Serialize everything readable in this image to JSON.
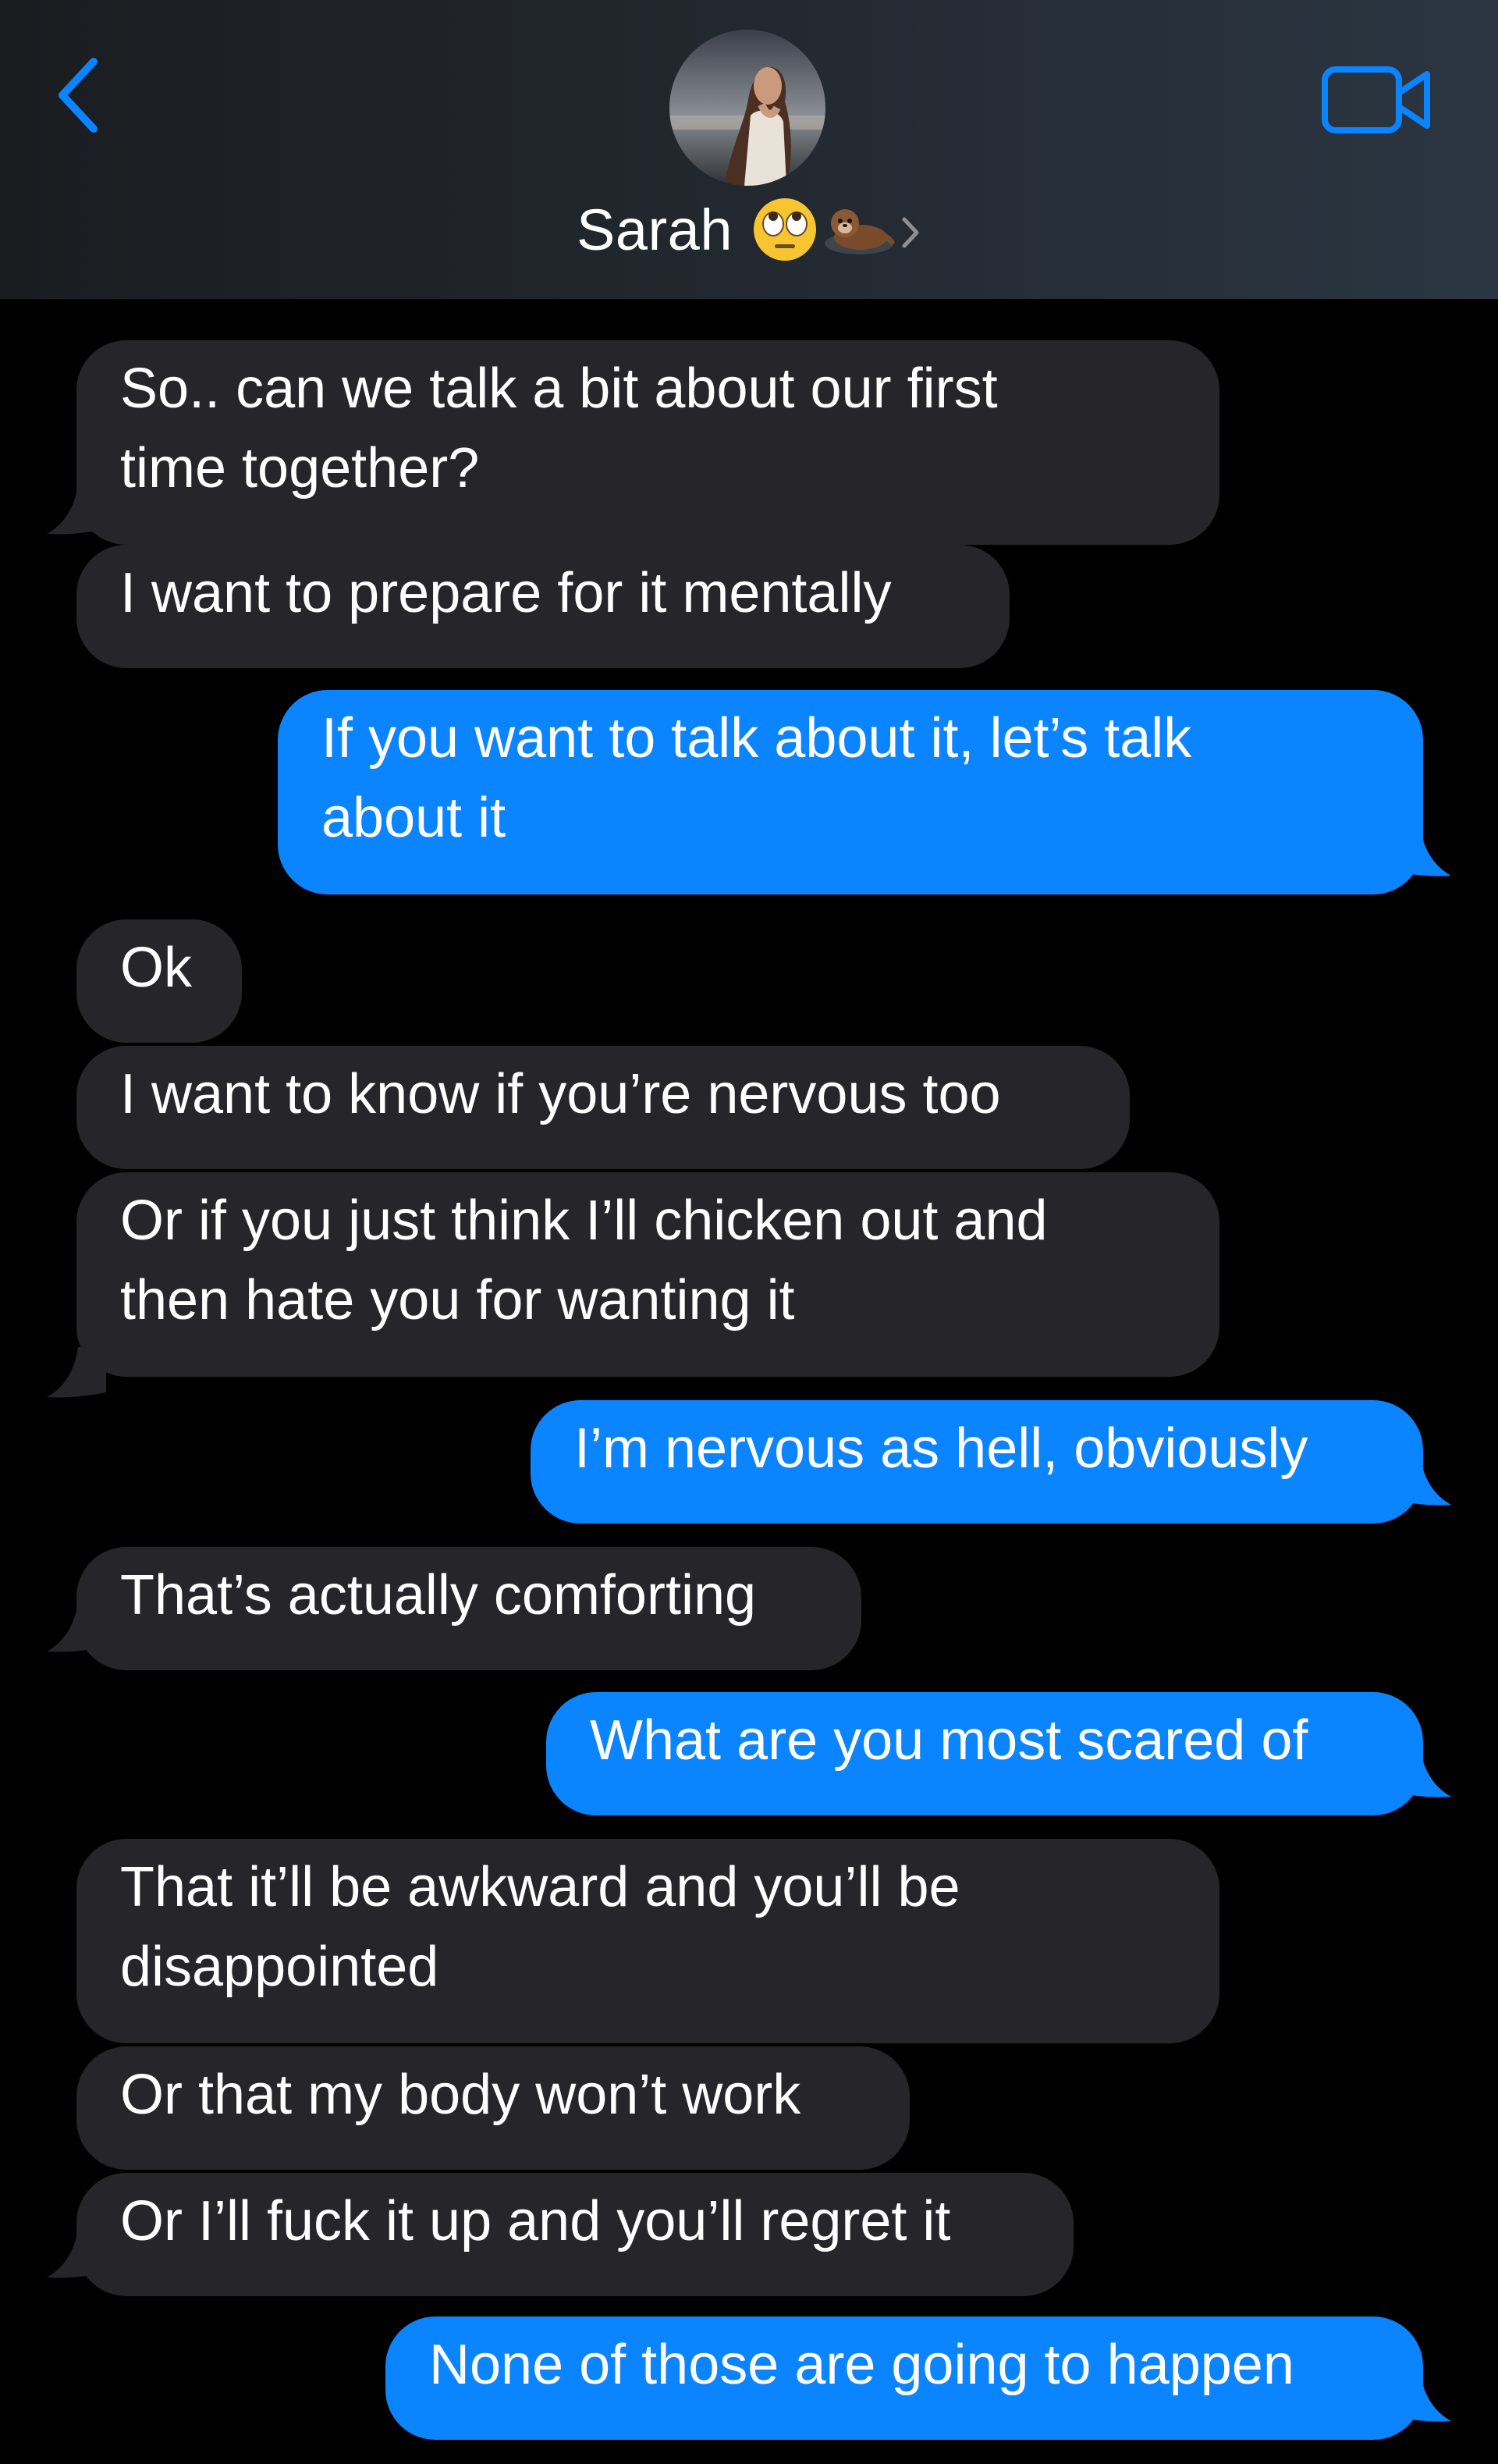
{
  "header": {
    "contact_name": "Sarah",
    "contact_emojis": [
      "face-with-rolling-eyes",
      "otter"
    ]
  },
  "colors": {
    "sent_bubble": "#0a84ff",
    "received_bubble": "#26262a",
    "accent": "#0a84ff",
    "background": "#000000"
  },
  "messages": [
    {
      "direction": "received",
      "text": "So.. can we talk a bit about our first\ntime together?"
    },
    {
      "direction": "received",
      "text": "I want to prepare for it mentally"
    },
    {
      "direction": "sent",
      "text": "If you want to talk about it, let’s talk\nabout it"
    },
    {
      "direction": "received",
      "text": "Ok"
    },
    {
      "direction": "received",
      "text": "I want to know if you’re nervous too"
    },
    {
      "direction": "received",
      "text": "Or if you just think I’ll chicken out and\nthen hate you for wanting it"
    },
    {
      "direction": "sent",
      "text": "I’m nervous as hell, obviously"
    },
    {
      "direction": "received",
      "text": "That’s actually comforting"
    },
    {
      "direction": "sent",
      "text": "What are you most scared of"
    },
    {
      "direction": "received",
      "text": "That it’ll be awkward and you’ll be\ndisappointed"
    },
    {
      "direction": "received",
      "text": "Or that my body won’t work"
    },
    {
      "direction": "received",
      "text": "Or I’ll fuck it up and you’ll regret it"
    },
    {
      "direction": "sent",
      "text": "None of those are going to happen"
    }
  ]
}
